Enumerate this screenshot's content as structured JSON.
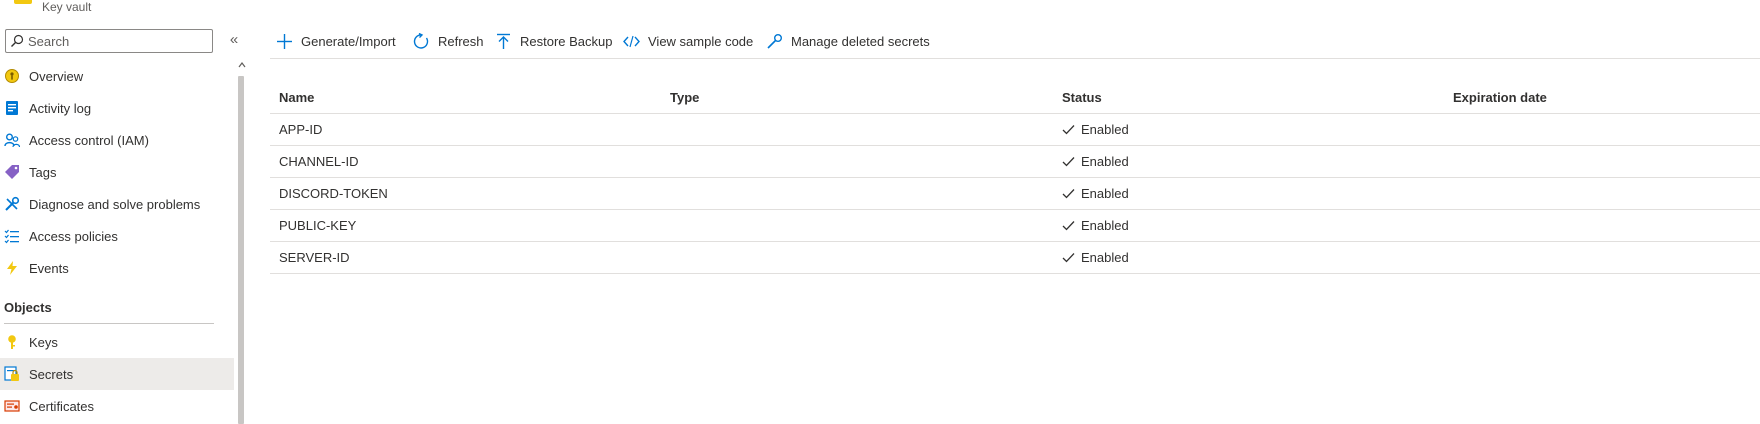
{
  "header": {
    "subtitle": "Key vault"
  },
  "sidebar": {
    "search_placeholder": "Search",
    "collapse_glyph": "«",
    "items": [
      {
        "label": "Overview",
        "icon": "overview-icon"
      },
      {
        "label": "Activity log",
        "icon": "activity-log-icon"
      },
      {
        "label": "Access control (IAM)",
        "icon": "access-control-icon"
      },
      {
        "label": "Tags",
        "icon": "tag-icon"
      },
      {
        "label": "Diagnose and solve problems",
        "icon": "wrench-icon"
      },
      {
        "label": "Access policies",
        "icon": "access-policies-icon"
      },
      {
        "label": "Events",
        "icon": "lightning-icon"
      }
    ],
    "objects_section": {
      "title": "Objects",
      "items": [
        {
          "label": "Keys",
          "icon": "key-icon"
        },
        {
          "label": "Secrets",
          "icon": "secrets-icon",
          "selected": true
        },
        {
          "label": "Certificates",
          "icon": "certificate-icon"
        }
      ]
    }
  },
  "toolbar": {
    "generate_import": "Generate/Import",
    "refresh": "Refresh",
    "restore_backup": "Restore Backup",
    "view_sample_code": "View sample code",
    "manage_deleted_secrets": "Manage deleted secrets"
  },
  "table": {
    "columns": [
      "Name",
      "Type",
      "Status",
      "Expiration date"
    ],
    "rows": [
      {
        "name": "APP-ID",
        "type": "",
        "status": "Enabled",
        "expiration": ""
      },
      {
        "name": "CHANNEL-ID",
        "type": "",
        "status": "Enabled",
        "expiration": ""
      },
      {
        "name": "DISCORD-TOKEN",
        "type": "",
        "status": "Enabled",
        "expiration": ""
      },
      {
        "name": "PUBLIC-KEY",
        "type": "",
        "status": "Enabled",
        "expiration": ""
      },
      {
        "name": "SERVER-ID",
        "type": "",
        "status": "Enabled",
        "expiration": ""
      }
    ]
  },
  "colors": {
    "accent": "#0078d4",
    "selected_bg": "#edebe9",
    "divider": "#e1dfdd",
    "text": "#323130"
  }
}
